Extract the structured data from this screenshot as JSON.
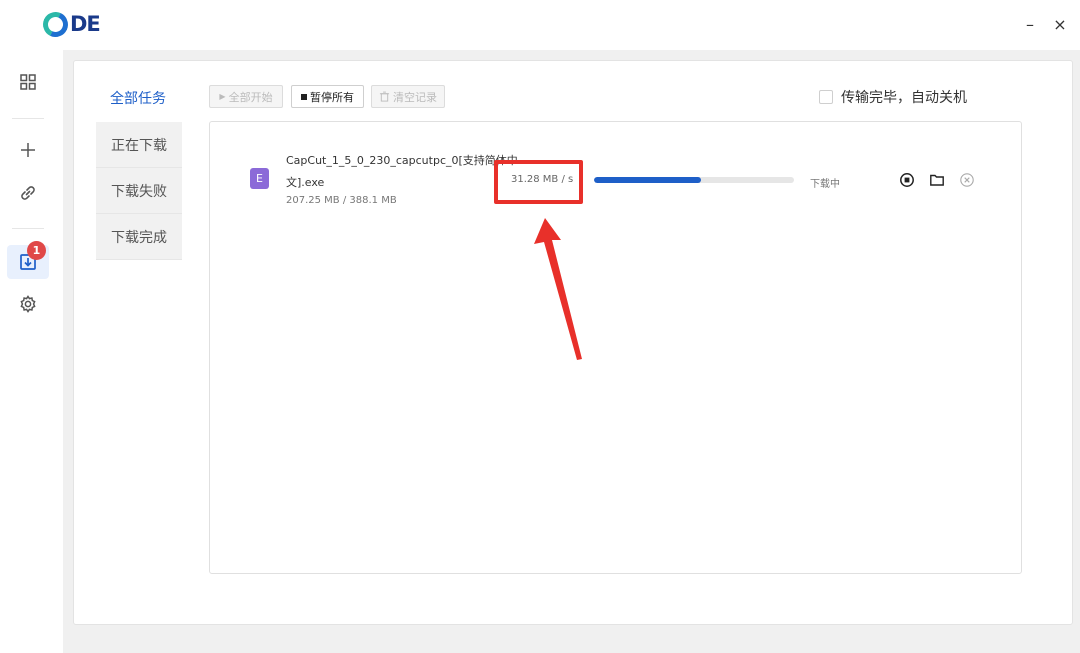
{
  "app": {
    "logo_text": "DE"
  },
  "window": {
    "minimize_label": "–",
    "close_label": "×"
  },
  "sidenav": {
    "badge_count": "1",
    "items": [
      {
        "icon": "grid-icon"
      },
      {
        "icon": "plus-icon"
      },
      {
        "icon": "link-icon"
      },
      {
        "icon": "download-icon",
        "active": true
      },
      {
        "icon": "gear-icon"
      }
    ]
  },
  "categories": {
    "all": "全部任务",
    "downloading": "正在下载",
    "failed": "下载失败",
    "completed": "下载完成"
  },
  "toolbar": {
    "start_all": "全部开始",
    "pause_all": "暂停所有",
    "clear_records": "清空记录"
  },
  "auto_shutdown": {
    "label": "传输完毕，自动关机",
    "checked": false
  },
  "download": {
    "icon_letter": "E",
    "filename_line1": "CapCut_1_5_0_230_capcutpc_0[支持简体中",
    "filename_line2": "文].exe",
    "size": "207.25 MB / 388.1 MB",
    "speed": "31.28 MB / s",
    "progress": 0.534,
    "status": "下载中"
  },
  "colors": {
    "accent": "#1e5fc8",
    "annotation": "#e8302a",
    "badge": "#e04848"
  }
}
